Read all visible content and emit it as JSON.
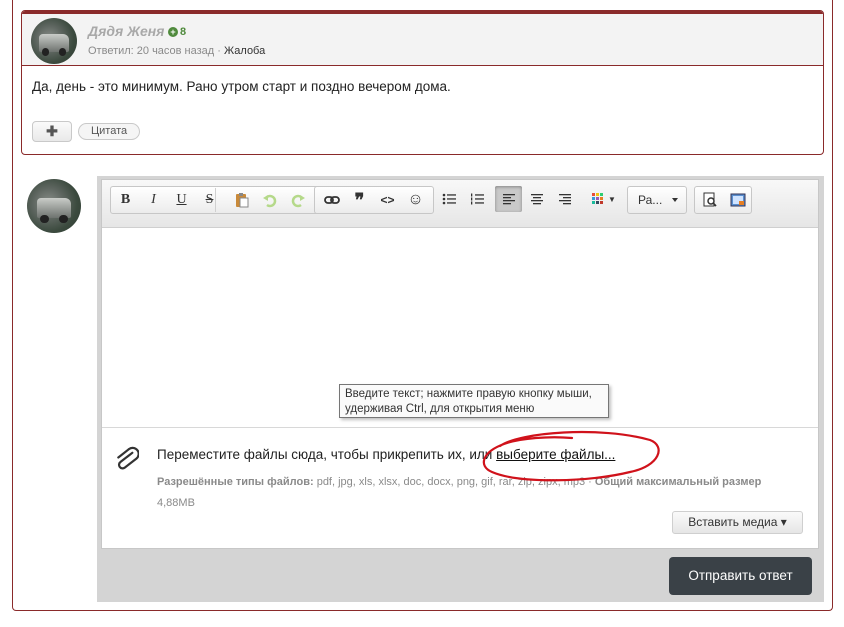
{
  "post": {
    "author": "Дядя Женя",
    "reputation": "8",
    "meta_time": "Ответил: 20 часов назад",
    "meta_sep": " · ",
    "report_label": "Жалоба",
    "body": "Да, день - это минимум. Рано утром старт и поздно вечером дома.",
    "plus_label": "✚",
    "quote_label": "Цитата"
  },
  "toolbar": {
    "bold": "B",
    "italic": "I",
    "underline": "U",
    "strike": "S",
    "font_select": "Ра..."
  },
  "editor": {
    "tooltip": "Введите текст; нажмите правую кнопку мыши, удерживая Ctrl, для открытия меню"
  },
  "attachments": {
    "drop_text": "Переместите файлы сюда, чтобы прикрепить их, или ",
    "drop_link": "выберите файлы...",
    "allowed_label": "Разрешённые типы файлов:",
    "allowed_types": " pdf, jpg, xls, xlsx, doc, docx, png, gif, rar, zip, zipx, mp3 · ",
    "max_size_label": "Общий максимальный размер",
    "max_size_value": "4,88MB",
    "insert_media_label": "Вставить медиа ▾"
  },
  "submit_label": "Отправить ответ",
  "colors": {
    "frame": "#8a2a2a",
    "reputation": "#4f8a3c",
    "submit_bg": "#3a4147",
    "annotation": "#d0121b"
  }
}
